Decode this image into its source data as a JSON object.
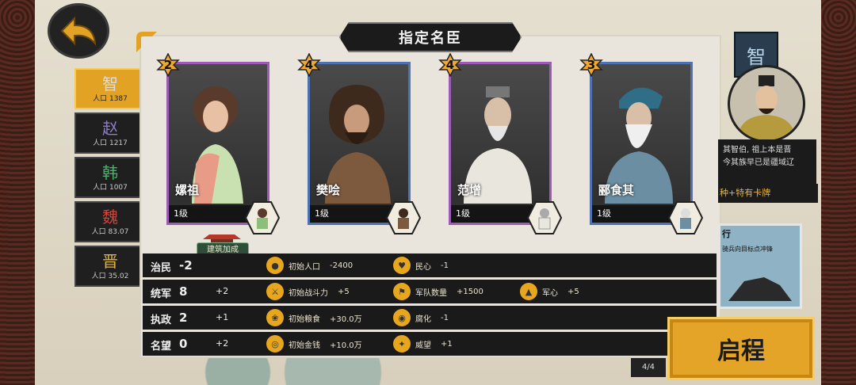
{
  "title": "指定名臣",
  "kingdoms": [
    {
      "name": "智",
      "pop": "人口 1387",
      "active": true
    },
    {
      "name": "赵",
      "pop": "人口 1217",
      "active": false
    },
    {
      "name": "韩",
      "pop": "人口 1007",
      "active": false
    },
    {
      "name": "魏",
      "pop": "人口 83.07",
      "active": false
    },
    {
      "name": "晋",
      "pop": "人口 35.02",
      "active": false
    }
  ],
  "cards": [
    {
      "name": "嫘祖",
      "level": "1级",
      "cost": "2",
      "color": "purple"
    },
    {
      "name": "樊哙",
      "level": "1级",
      "cost": "4",
      "color": "blue"
    },
    {
      "name": "范增",
      "level": "1级",
      "cost": "4",
      "color": "purple"
    },
    {
      "name": "郦食其",
      "level": "1级",
      "cost": "3",
      "color": "blue"
    }
  ],
  "build_bonus": "建筑加成",
  "stats": [
    {
      "name": "治民",
      "value": "-2",
      "bonus": "",
      "effects": [
        {
          "icon": "population-icon",
          "label": "初始人口",
          "value": "-2400"
        },
        {
          "icon": "morale-icon",
          "label": "民心",
          "value": "-1"
        }
      ]
    },
    {
      "name": "统军",
      "value": "8",
      "bonus": "+2",
      "effects": [
        {
          "icon": "combat-icon",
          "label": "初始战斗力",
          "value": "+5"
        },
        {
          "icon": "troops-icon",
          "label": "军队数量",
          "value": "+1500"
        },
        {
          "icon": "army-morale-icon",
          "label": "军心",
          "value": "+5"
        }
      ]
    },
    {
      "name": "执政",
      "value": "2",
      "bonus": "+1",
      "effects": [
        {
          "icon": "grain-icon",
          "label": "初始粮食",
          "value": "+30.0万"
        },
        {
          "icon": "corruption-icon",
          "label": "腐化",
          "value": "-1"
        }
      ]
    },
    {
      "name": "名望",
      "value": "0",
      "bonus": "+2",
      "effects": [
        {
          "icon": "coin-icon",
          "label": "初始金钱",
          "value": "+10.0万"
        },
        {
          "icon": "prestige-icon",
          "label": "威望",
          "value": "+1"
        }
      ]
    }
  ],
  "right": {
    "banner": "智",
    "desc_line1": "其智伯, 祖上本是晋",
    "desc_line2": "今其族早已是疆域辽",
    "special": "种+特有卡牌",
    "preview_title": "行",
    "preview_desc": "骑兵向目标点冲锋"
  },
  "start_label": "启程",
  "page_indicator": "4/4",
  "colors": {
    "accent": "#e3a427",
    "purple": "#9c5bb5",
    "blue": "#4f72b1"
  }
}
